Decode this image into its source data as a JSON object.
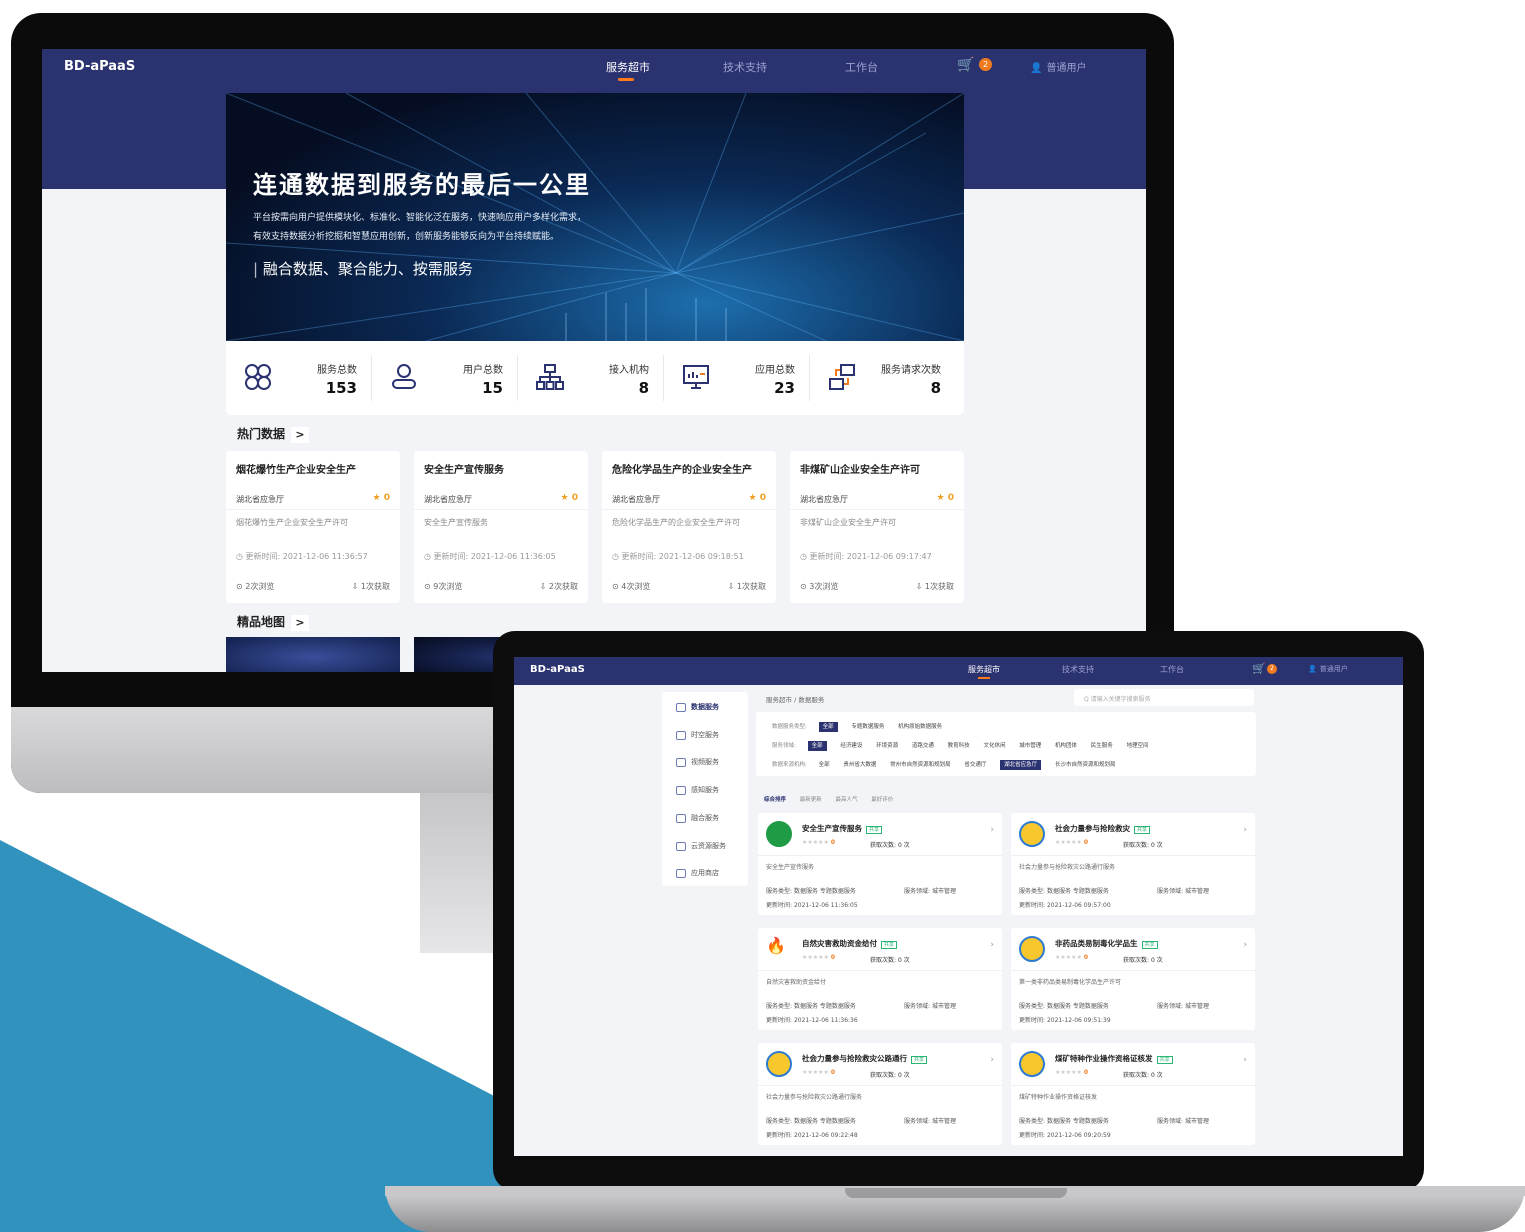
{
  "colors": {
    "brand": "#2b3270",
    "accent": "#f07a1e",
    "bg": "#f2f4f8",
    "teal": "#3193bd"
  },
  "desktop": {
    "logo": "BD-aPaaS",
    "nav": [
      "服务超市",
      "技术支持",
      "工作台"
    ],
    "cart_count": "2",
    "user": "普通用户",
    "hero": {
      "title": "连通数据到服务的最后一公里",
      "line1": "平台按需向用户提供模块化、标准化、智能化泛在服务，快速响应用户多样化需求，",
      "line2": "有效支持数据分析挖掘和智慧应用创新，创新服务能够反向为平台持续赋能。",
      "slogan": "融合数据、聚合能力、按需服务"
    },
    "stats": [
      {
        "label": "服务总数",
        "value": "153",
        "icon": "clover-icon"
      },
      {
        "label": "用户总数",
        "value": "15",
        "icon": "user-icon"
      },
      {
        "label": "接入机构",
        "value": "8",
        "icon": "org-tree-icon"
      },
      {
        "label": "应用总数",
        "value": "23",
        "icon": "monitor-chart-icon"
      },
      {
        "label": "服务请求次数",
        "value": "8",
        "icon": "request-icon"
      }
    ],
    "hot_title": "热门数据",
    "map_title": "精品地图",
    "more": ">",
    "cards": [
      {
        "title": "烟花爆竹生产企业安全生产",
        "org": "湖北省应急厅",
        "stars": "★ 0",
        "desc": "烟花爆竹生产企业安全生产许可",
        "updated": "◷ 更新时间: 2021-12-06 11:36:57",
        "views": "⊙ 2次浏览",
        "gets": "⇩ 1次获取"
      },
      {
        "title": "安全生产宣传服务",
        "org": "湖北省应急厅",
        "stars": "★ 0",
        "desc": "安全生产宣传服务",
        "updated": "◷ 更新时间: 2021-12-06 11:36:05",
        "views": "⊙ 9次浏览",
        "gets": "⇩ 2次获取"
      },
      {
        "title": "危险化学品生产的企业安全生产",
        "org": "湖北省应急厅",
        "stars": "★ 0",
        "desc": "危险化学品生产的企业安全生产许可",
        "updated": "◷ 更新时间: 2021-12-06 09:18:51",
        "views": "⊙ 4次浏览",
        "gets": "⇩ 1次获取"
      },
      {
        "title": "非煤矿山企业安全生产许可",
        "org": "湖北省应急厅",
        "stars": "★ 0",
        "desc": "非煤矿山企业安全生产许可",
        "updated": "◷ 更新时间: 2021-12-06 09:17:47",
        "views": "⊙ 3次浏览",
        "gets": "⇩ 1次获取"
      }
    ]
  },
  "laptop": {
    "logo": "BD-aPaaS",
    "nav": [
      "服务超市",
      "技术支持",
      "工作台"
    ],
    "cart_count": "2",
    "user": "普通用户",
    "breadcrumb": "服务超市  /  数据服务",
    "search_placeholder": "Q  请输入关键字搜索服务",
    "sidebar": [
      "数据服务",
      "时空服务",
      "视频服务",
      "感知服务",
      "融合服务",
      "云资源服务",
      "应用商店"
    ],
    "filters": [
      {
        "label": "数据服务类型:",
        "options": [
          "全部",
          "专题数据服务",
          "机构原始数据服务"
        ],
        "active": 0
      },
      {
        "label": "服务领域:",
        "options": [
          "全部",
          "经济建设",
          "环境资源",
          "道路交通",
          "教育科技",
          "文化休闲",
          "城市管理",
          "机构团体",
          "民生服务",
          "地理空间"
        ],
        "active": 0
      },
      {
        "label": "数据来源机构:",
        "options": [
          "全部",
          "贵州省大数据",
          "常州市自然资源和规划局",
          "省交通厅",
          "湖北省应急厅",
          "长沙市自然资源和规划局"
        ],
        "active": 4
      }
    ],
    "sort": [
      "综合排序",
      "最新更新",
      "最高人气",
      "最好评价"
    ],
    "shared_tag": "共享",
    "get_label": "获取次数:",
    "type_label": "服务类型:",
    "domain_label": "服务领域:",
    "update_label": "更新时间:",
    "services": [
      {
        "name": "安全生产宣传服务",
        "logo": "g",
        "rating": "0",
        "gets": "0 次",
        "desc": "安全生产宣传服务",
        "type": "数据服务  专题数据服务",
        "domain": "城市管理",
        "updated": "2021-12-06 11:36:05"
      },
      {
        "name": "社会力量参与抢险救灾",
        "logo": "b",
        "rating": "0",
        "gets": "0 次",
        "desc": "社会力量参与抢险救灾公路通行服务",
        "type": "数据服务  专题数据服务",
        "domain": "城市管理",
        "updated": "2021-12-06 09:57:00"
      },
      {
        "name": "自然灾害救助资金给付",
        "logo": "f",
        "rating": "0",
        "gets": "0 次",
        "desc": "自然灾害救助资金给付",
        "type": "数据服务  专题数据服务",
        "domain": "城市管理",
        "updated": "2021-12-06 11:36:36"
      },
      {
        "name": "非药品类易制毒化学品生",
        "logo": "b",
        "rating": "0",
        "gets": "0 次",
        "desc": "第一类非药品类易制毒化学品生产许可",
        "type": "数据服务  专题数据服务",
        "domain": "城市管理",
        "updated": "2021-12-06 09:51:39"
      },
      {
        "name": "社会力量参与抢险救灾公路通行",
        "logo": "b",
        "rating": "0",
        "gets": "0 次",
        "desc": "社会力量参与抢险救灾公路通行服务",
        "type": "数据服务  专题数据服务",
        "domain": "城市管理",
        "updated": "2021-12-06 09:22:48"
      },
      {
        "name": "煤矿特种作业操作资格证核发",
        "logo": "b",
        "rating": "0",
        "gets": "0 次",
        "desc": "煤矿特种作业操作资格证核发",
        "type": "数据服务  专题数据服务",
        "domain": "城市管理",
        "updated": "2021-12-06 09:20:59"
      }
    ]
  }
}
